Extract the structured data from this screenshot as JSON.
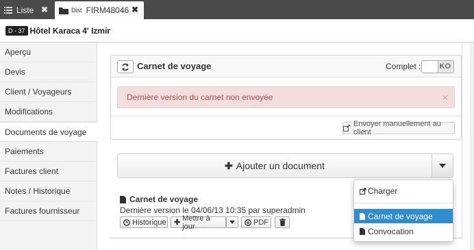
{
  "tabs": [
    {
      "label": "Liste"
    },
    {
      "prefix": "Dist",
      "label": "FIRM48046"
    }
  ],
  "header": {
    "badge": "D - 37",
    "hotel": "Hôtel Karaca 4' Izmir"
  },
  "sidebar": {
    "items": [
      {
        "label": "Aperçu"
      },
      {
        "label": "Devis"
      },
      {
        "label": "Client / Voyageurs"
      },
      {
        "label": "Modifications"
      },
      {
        "label": "Documents de voyage",
        "active": true
      },
      {
        "label": "Paiements"
      },
      {
        "label": "Factures client"
      },
      {
        "label": "Notes / Historique"
      },
      {
        "label": "Factures fournisseur"
      }
    ]
  },
  "panel": {
    "title": "Carnet de voyage",
    "complet_label": "Complet :",
    "toggle_state": "KO",
    "alert": "Dernière version du carnet non envoyée",
    "send_button": "Envoyer manuellement au client"
  },
  "add_document": {
    "label": "Ajouter un document"
  },
  "document": {
    "title": "Carnet de voyage",
    "info": "Dernière version le 04/06/13 10:35 par superadmin",
    "buttons": {
      "history": "Historique",
      "update": "Mettre à jour",
      "pdf": "PDF"
    }
  },
  "dropdown": {
    "items": [
      {
        "label": "Charger"
      },
      {
        "label": "Carnet de voyage",
        "highlighted": true
      },
      {
        "label": "Convocation"
      }
    ]
  },
  "colors": {
    "highlight": "#2e8ccf",
    "alert_bg": "#f2dede",
    "alert_text": "#b94a48"
  }
}
